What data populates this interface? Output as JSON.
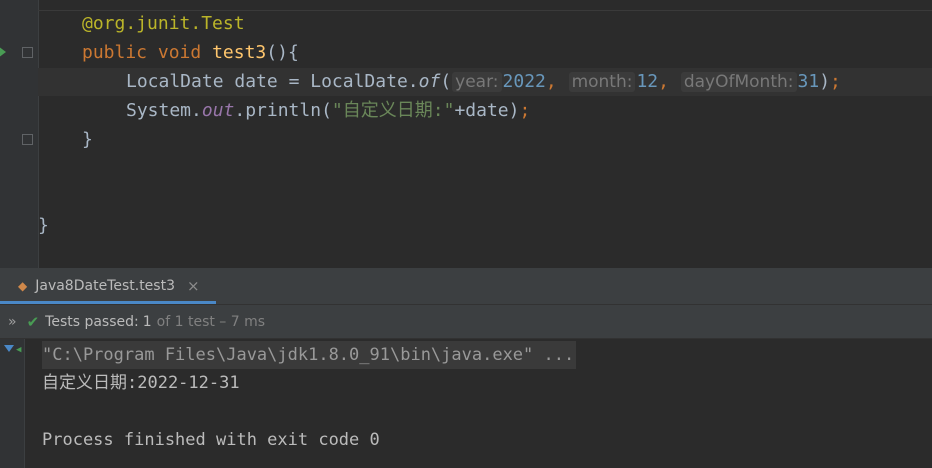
{
  "editor": {
    "annotation": "@org.junit.Test",
    "kw_public": "public",
    "kw_void": "void",
    "method_name": "test3",
    "method_tail": "(){",
    "line3": {
      "type": "LocalDate",
      "assign": " date = LocalDate.",
      "call": "of",
      "open": "(",
      "hint_year": "year:",
      "year": "2022",
      "hint_month": "month:",
      "month": "12",
      "hint_day": "dayOfMonth:",
      "day": "31",
      "close": ")",
      "semi": ";"
    },
    "line4": {
      "prefix": "System.",
      "field": "out",
      "method": ".println(",
      "string": "\"自定义日期:\"",
      "tail": "+date)",
      "semi": ";"
    },
    "close_method": "}",
    "close_class": "}"
  },
  "run_panel": {
    "tab_label": "Java8DateTest.test3",
    "tab_close": "×",
    "status_main": "Tests passed:",
    "status_count": "1",
    "status_rest": "of 1 test – 7 ms"
  },
  "console": {
    "cmd": "\"C:\\Program Files\\Java\\jdk1.8.0_91\\bin\\java.exe\" ...",
    "output": "自定义日期:2022-12-31",
    "exit": "Process finished with exit code 0"
  },
  "colors": {
    "keyword": "#cc7832",
    "function": "#ffc66d",
    "number": "#6897bb",
    "string": "#6a8759",
    "annotation": "#bbb529",
    "passed": "#499c54"
  }
}
